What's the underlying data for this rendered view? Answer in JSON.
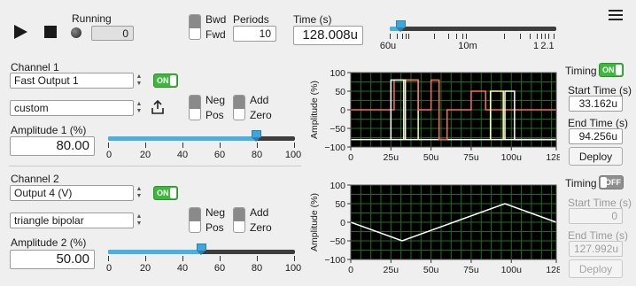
{
  "run_control": {
    "running_label": "Running",
    "running_count": "0",
    "bwd_label": "Bwd",
    "fwd_label": "Fwd",
    "periods_label": "Periods",
    "periods_value": "10",
    "time_label": "Time (s)",
    "time_value": "128.008u",
    "time_slider": {
      "tick_labels": [
        "60u",
        "10m",
        "1",
        "2.1"
      ],
      "position_fraction": 0.05
    }
  },
  "channels": [
    {
      "title": "Channel 1",
      "output": "Fast Output 1",
      "enabled_label": "ON",
      "waveform": "custom",
      "neg_label": "Neg",
      "pos_label": "Pos",
      "add_label": "Add",
      "zero_label": "Zero",
      "amplitude_label": "Amplitude 1 (%)",
      "amplitude_value": "80.00",
      "amplitude_slider_fraction": 0.8,
      "slider_ticks": [
        "0",
        "20",
        "40",
        "60",
        "80",
        "100"
      ],
      "timing": {
        "label": "Timing",
        "state_label": "ON",
        "enabled": true,
        "start_label": "Start Time (s)",
        "start_value": "33.162u",
        "end_label": "End Time (s)",
        "end_value": "94.256u",
        "deploy_label": "Deploy"
      }
    },
    {
      "title": "Channel 2",
      "output": "Output 4 (V)",
      "enabled_label": "ON",
      "waveform": "triangle bipolar",
      "neg_label": "Neg",
      "pos_label": "Pos",
      "add_label": "Add",
      "zero_label": "Zero",
      "amplitude_label": "Amplitude 2 (%)",
      "amplitude_value": "50.00",
      "amplitude_slider_fraction": 0.5,
      "slider_ticks": [
        "0",
        "20",
        "40",
        "60",
        "80",
        "100"
      ],
      "timing": {
        "label": "Timing",
        "state_label": "OFF",
        "enabled": false,
        "start_label": "Start Time (s)",
        "start_value": "0",
        "end_label": "End Time (s)",
        "end_value": "127.992u",
        "deploy_label": "Deploy"
      }
    }
  ],
  "icons": {
    "play": "play-icon",
    "stop": "stop-icon",
    "led": "status-led-icon",
    "export": "export-icon",
    "menu": "hamburger-menu-icon"
  },
  "chart_data": [
    {
      "type": "line",
      "ylabel": "Amplitude (%)",
      "xlabel": "",
      "x_tick_labels": [
        "0",
        "25u",
        "50u",
        "75u",
        "100u",
        "128u"
      ],
      "x_ticks": [
        0,
        25,
        50,
        75,
        100,
        128
      ],
      "y_tick_labels": [
        "100",
        "50",
        "0",
        "−50",
        "−100"
      ],
      "y_ticks": [
        100,
        50,
        0,
        -50,
        -100
      ],
      "xlim": [
        0,
        128
      ],
      "ylim": [
        -100,
        100
      ],
      "grid": true,
      "series": [
        {
          "color": "#ffffff",
          "x": [
            0,
            25,
            25,
            33,
            33,
            94,
            94,
            128
          ],
          "y": [
            -80,
            -80,
            -80,
            -80,
            -80,
            -80,
            -80,
            -80
          ]
        },
        {
          "color": "#ffff99",
          "x": [
            33,
            33,
            42,
            42
          ],
          "y": [
            -80,
            80,
            80,
            -80
          ]
        },
        {
          "color": "#ff6b5c",
          "x": [
            0,
            27,
            27,
            42,
            42,
            50,
            50,
            55,
            55,
            60
          ],
          "y": [
            0,
            0,
            80,
            80,
            0,
            0,
            80,
            80,
            -80,
            -80
          ]
        },
        {
          "color": "#ffffff",
          "x": [
            25,
            25,
            34,
            34
          ],
          "y": [
            -80,
            80,
            80,
            -80
          ]
        },
        {
          "color": "#ff6b5c",
          "x": [
            60,
            60,
            75,
            75,
            84,
            84,
            87,
            87,
            128
          ],
          "y": [
            -80,
            0,
            0,
            50,
            50,
            0,
            0,
            0,
            0
          ]
        },
        {
          "color": "#ffff99",
          "x": [
            87,
            87,
            95,
            95
          ],
          "y": [
            -80,
            50,
            50,
            -80
          ]
        },
        {
          "color": "#ffffff",
          "x": [
            96,
            96,
            102,
            102,
            128
          ],
          "y": [
            -80,
            50,
            50,
            -80,
            -80
          ]
        }
      ]
    },
    {
      "type": "line",
      "ylabel": "Amplitude (%)",
      "xlabel": "",
      "x_tick_labels": [
        "0",
        "25u",
        "50u",
        "75u",
        "100u",
        "128u"
      ],
      "x_ticks": [
        0,
        25,
        50,
        75,
        100,
        128
      ],
      "y_tick_labels": [
        "100",
        "50",
        "0",
        "−50",
        "−100"
      ],
      "y_ticks": [
        100,
        50,
        0,
        -50,
        -100
      ],
      "xlim": [
        0,
        128
      ],
      "ylim": [
        -100,
        100
      ],
      "grid": true,
      "series": [
        {
          "color": "#ffffff",
          "x": [
            0,
            32,
            96,
            128
          ],
          "y": [
            0,
            -50,
            50,
            0
          ]
        }
      ]
    }
  ]
}
